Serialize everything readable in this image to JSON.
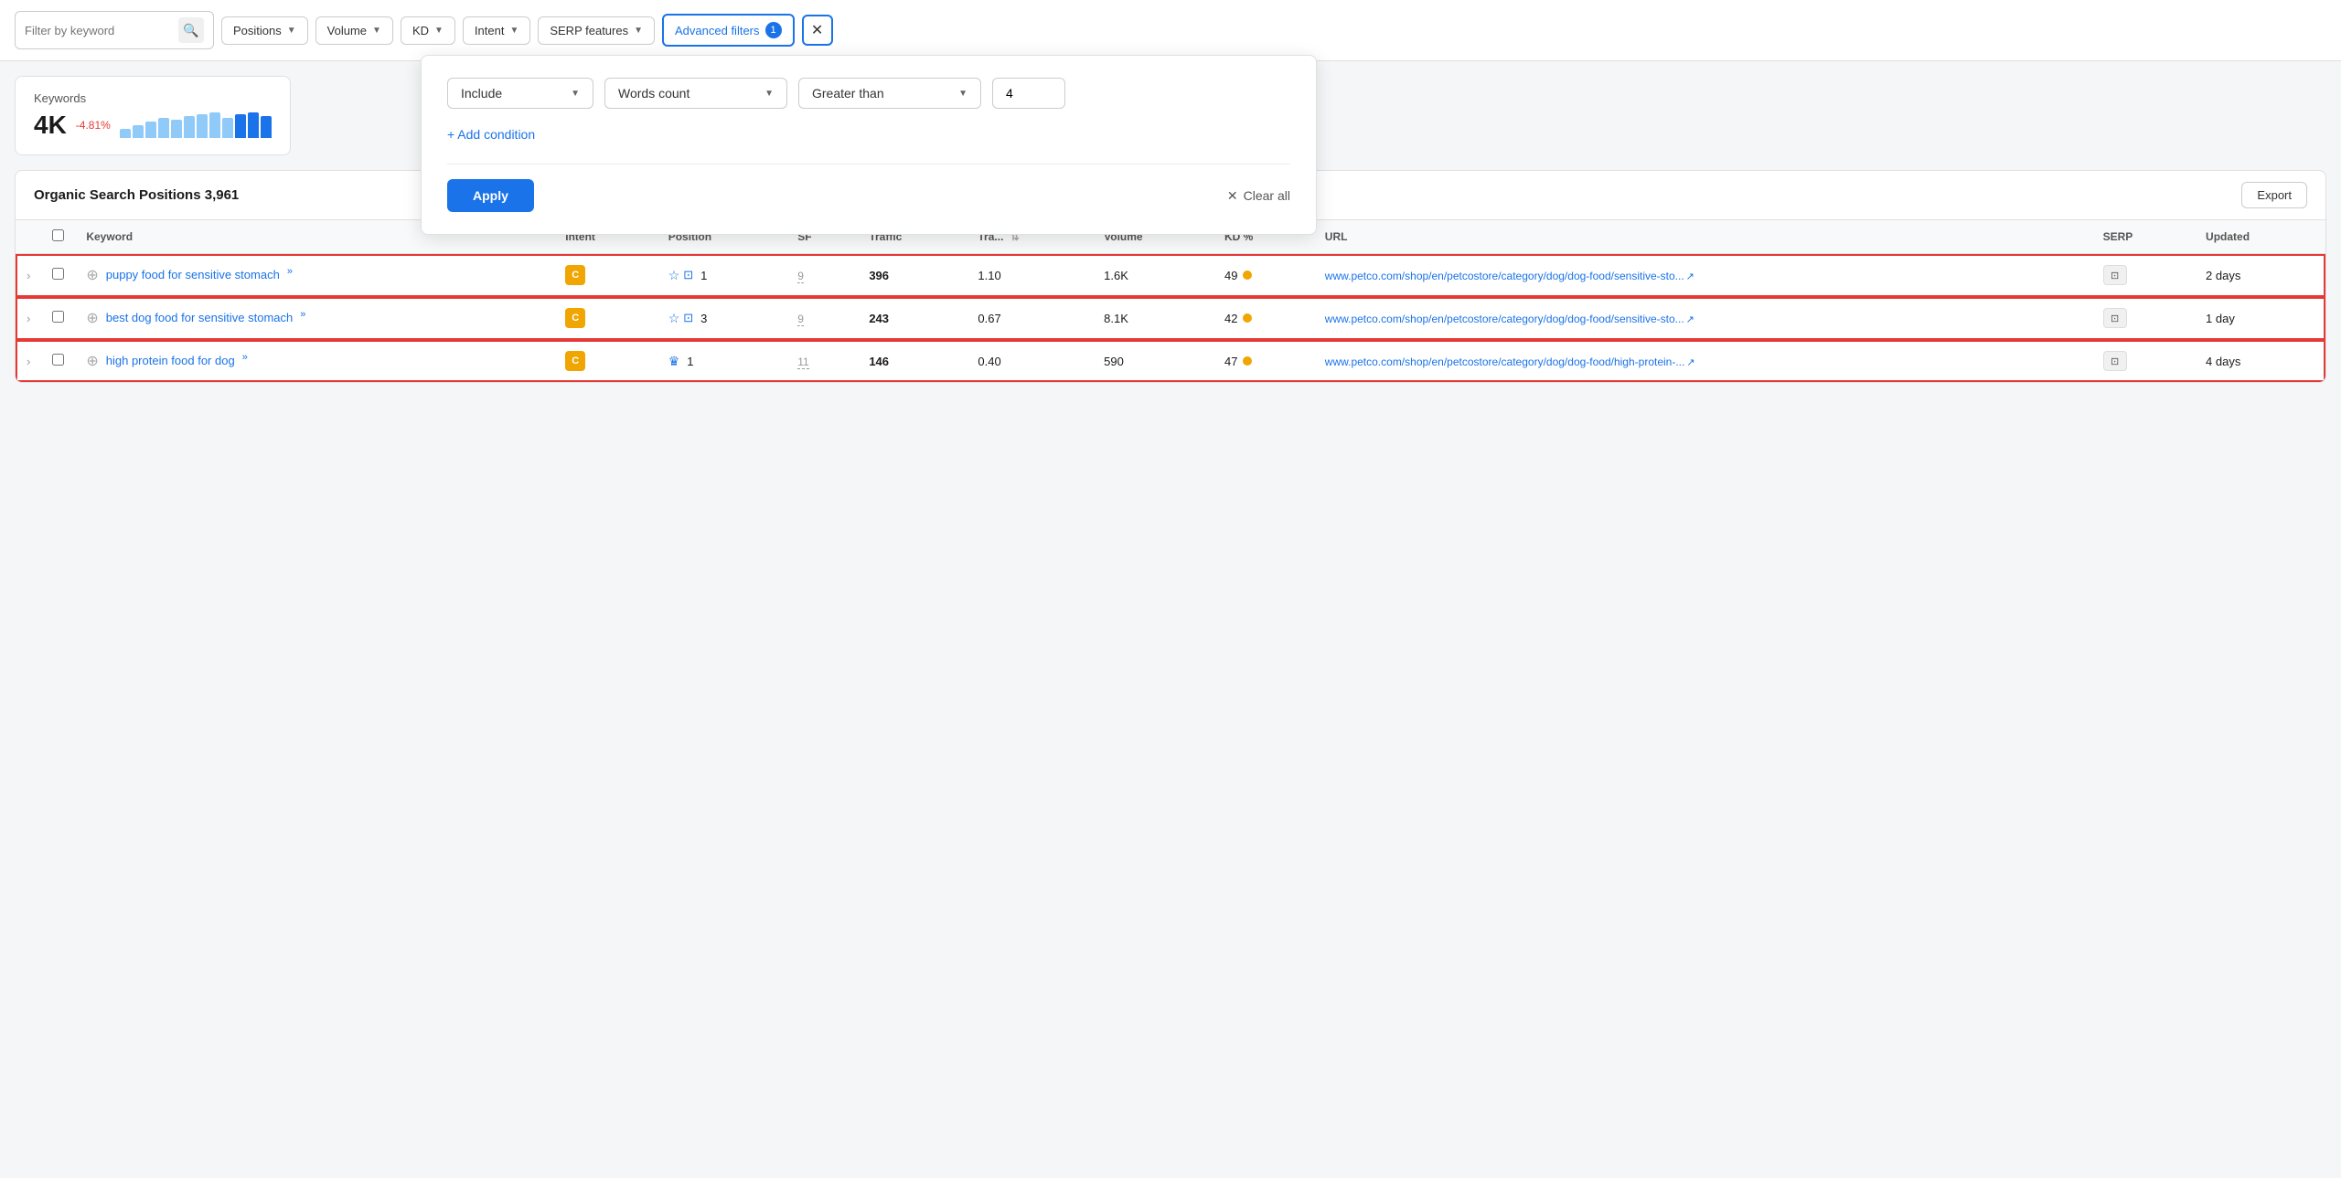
{
  "toolbar": {
    "filter_placeholder": "Filter by keyword",
    "positions_label": "Positions",
    "volume_label": "Volume",
    "kd_label": "KD",
    "intent_label": "Intent",
    "serp_features_label": "SERP features",
    "advanced_filters_label": "Advanced filters",
    "advanced_filters_badge": "1"
  },
  "dropdown_panel": {
    "include_label": "Include",
    "words_count_label": "Words count",
    "greater_than_label": "Greater than",
    "filter_value": "4",
    "add_condition_label": "+ Add condition",
    "apply_label": "Apply",
    "clear_all_label": "Clear all"
  },
  "stats": {
    "label": "Keywords",
    "value": "4K",
    "change": "-4.81%"
  },
  "table_section": {
    "title": "Organic Search Positions",
    "count": "3,961",
    "export_label": "Export"
  },
  "columns": {
    "keyword": "Keyword",
    "intent": "Intent",
    "position": "Position",
    "sf": "SF",
    "traffic": "Traffic",
    "traffic_change": "Tra...",
    "volume": "Volume",
    "kd_pct": "KD %",
    "url": "URL",
    "serp": "SERP",
    "updated": "Updated"
  },
  "rows": [
    {
      "keyword": "puppy food for sensitive stomach",
      "intent": "C",
      "sf_star": true,
      "sf_img": true,
      "position": "1",
      "sf_count": "9",
      "traffic": "396",
      "traffic_change": "1.10",
      "volume": "1.6K",
      "kd": "49",
      "url": "www.petco.com/shop/en/petcostore/category/dog/dog-food/sensitive-sto...",
      "serp": "",
      "updated": "2 days",
      "highlight": true,
      "crown": false
    },
    {
      "keyword": "best dog food for sensitive stomach",
      "intent": "C",
      "sf_star": true,
      "sf_img": true,
      "position": "3",
      "sf_count": "9",
      "traffic": "243",
      "traffic_change": "0.67",
      "volume": "8.1K",
      "kd": "42",
      "url": "www.petco.com/shop/en/petcostore/category/dog/dog-food/sensitive-sto...",
      "serp": "",
      "updated": "1 day",
      "highlight": true,
      "crown": false
    },
    {
      "keyword": "high protein food for dog",
      "intent": "C",
      "sf_star": false,
      "sf_img": false,
      "position": "1",
      "sf_count": "11",
      "traffic": "146",
      "traffic_change": "0.40",
      "volume": "590",
      "kd": "47",
      "url": "www.petco.com/shop/en/petcostore/category/dog/dog-food/high-protein-...",
      "serp": "",
      "updated": "4 days",
      "highlight": true,
      "crown": true
    }
  ],
  "bars": [
    10,
    14,
    18,
    22,
    20,
    24,
    26,
    28,
    22,
    26,
    28,
    24
  ]
}
